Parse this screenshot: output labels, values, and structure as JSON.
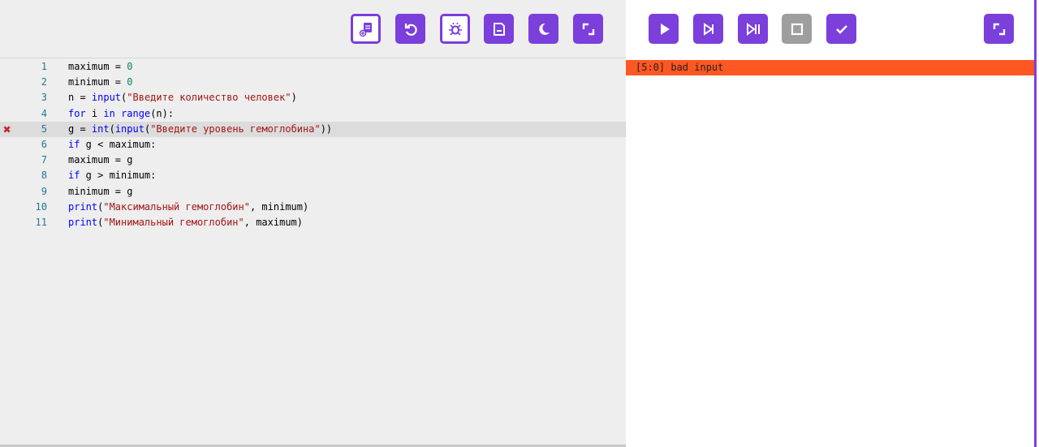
{
  "colors": {
    "accent": "#7b3fdb",
    "error": "#ff5722",
    "disabled": "#9e9e9e"
  },
  "editor_toolbar": [
    {
      "name": "new-file-button",
      "icon": "new-file-icon"
    },
    {
      "name": "reset-button",
      "icon": "undo-icon"
    },
    {
      "name": "debug-button",
      "icon": "bug-icon"
    },
    {
      "name": "save-button",
      "icon": "save-icon"
    },
    {
      "name": "theme-button",
      "icon": "moon-icon"
    },
    {
      "name": "expand-editor-button",
      "icon": "expand-icon"
    }
  ],
  "run_toolbar": [
    {
      "name": "run-button",
      "icon": "play-icon"
    },
    {
      "name": "step-button",
      "icon": "step-icon"
    },
    {
      "name": "step-over-button",
      "icon": "step-over-icon"
    },
    {
      "name": "stop-button",
      "icon": "stop-icon"
    },
    {
      "name": "check-button",
      "icon": "check-icon"
    },
    {
      "name": "expand-output-button",
      "icon": "expand-icon"
    }
  ],
  "editor": {
    "error_line": 5,
    "lines": [
      [
        [
          "maximum = ",
          ""
        ],
        [
          "0",
          "num"
        ]
      ],
      [
        [
          "minimum = ",
          ""
        ],
        [
          "0",
          "num"
        ]
      ],
      [
        [
          "n = ",
          ""
        ],
        [
          "input",
          "fn"
        ],
        [
          "(",
          ""
        ],
        [
          "\"Введите количество человек\"",
          "str"
        ],
        [
          ")",
          ""
        ]
      ],
      [
        [
          "for",
          "kw"
        ],
        [
          " i ",
          ""
        ],
        [
          "in",
          "kw"
        ],
        [
          " ",
          ""
        ],
        [
          "range",
          "fn"
        ],
        [
          "(n):",
          ""
        ]
      ],
      [
        [
          "g = ",
          ""
        ],
        [
          "int",
          "fn"
        ],
        [
          "(",
          ""
        ],
        [
          "input",
          "fn"
        ],
        [
          "(",
          ""
        ],
        [
          "\"Введите уровень гемоглобина\"",
          "str"
        ],
        [
          "))",
          ""
        ]
      ],
      [
        [
          "if",
          "kw"
        ],
        [
          " g < maximum:",
          ""
        ]
      ],
      [
        [
          "maximum = g",
          ""
        ]
      ],
      [
        [
          "if",
          "kw"
        ],
        [
          " g > minimum:",
          ""
        ]
      ],
      [
        [
          "minimum = g",
          ""
        ]
      ],
      [
        [
          "print",
          "fn"
        ],
        [
          "(",
          ""
        ],
        [
          "\"Максимальный гемоглобин\"",
          "str"
        ],
        [
          ", minimum)",
          ""
        ]
      ],
      [
        [
          "print",
          "fn"
        ],
        [
          "(",
          ""
        ],
        [
          "\"Минимальный гемоглобин\"",
          "str"
        ],
        [
          ", maximum)",
          ""
        ]
      ]
    ]
  },
  "output": {
    "error_message": "[5:0] bad input"
  }
}
